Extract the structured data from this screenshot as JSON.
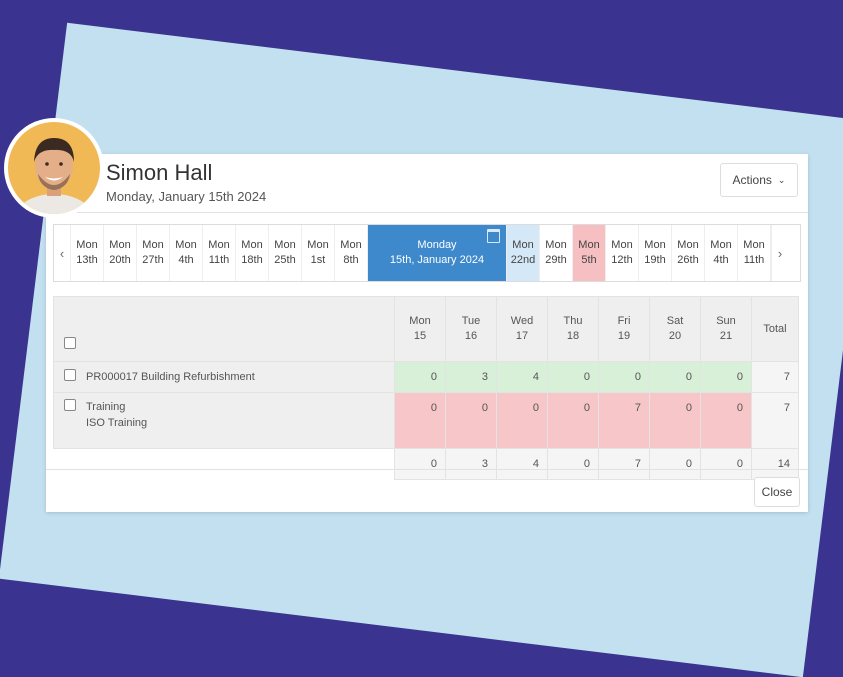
{
  "employee": {
    "name": "Simon Hall",
    "date": "Monday, January 15th 2024"
  },
  "actions_label": "Actions",
  "close_label": "Close",
  "colors": {
    "background": "#3a338f",
    "card": "#c2e0ef",
    "selected_week": "#3d89cc",
    "hours_ok": "#d8efd8",
    "hours_missing": "#f7c6c8"
  },
  "weeks": [
    {
      "day": "Mon",
      "date": "13th",
      "state": "normal"
    },
    {
      "day": "Mon",
      "date": "20th",
      "state": "normal"
    },
    {
      "day": "Mon",
      "date": "27th",
      "state": "normal"
    },
    {
      "day": "Mon",
      "date": "4th",
      "state": "normal"
    },
    {
      "day": "Mon",
      "date": "11th",
      "state": "normal"
    },
    {
      "day": "Mon",
      "date": "18th",
      "state": "normal"
    },
    {
      "day": "Mon",
      "date": "25th",
      "state": "normal"
    },
    {
      "day": "Mon",
      "date": "1st",
      "state": "normal"
    },
    {
      "day": "Mon",
      "date": "8th",
      "state": "normal"
    },
    {
      "day": "Monday",
      "date": "15th, January 2024",
      "state": "selected"
    },
    {
      "day": "Mon",
      "date": "22nd",
      "state": "blue"
    },
    {
      "day": "Mon",
      "date": "29th",
      "state": "normal"
    },
    {
      "day": "Mon",
      "date": "5th",
      "state": "pink"
    },
    {
      "day": "Mon",
      "date": "12th",
      "state": "normal"
    },
    {
      "day": "Mon",
      "date": "19th",
      "state": "normal"
    },
    {
      "day": "Mon",
      "date": "26th",
      "state": "normal"
    },
    {
      "day": "Mon",
      "date": "4th",
      "state": "normal"
    },
    {
      "day": "Mon",
      "date": "11th",
      "state": "normal"
    }
  ],
  "days": [
    {
      "day": "Mon",
      "num": "15"
    },
    {
      "day": "Tue",
      "num": "16"
    },
    {
      "day": "Wed",
      "num": "17"
    },
    {
      "day": "Thu",
      "num": "18"
    },
    {
      "day": "Fri",
      "num": "19"
    },
    {
      "day": "Sat",
      "num": "20"
    },
    {
      "day": "Sun",
      "num": "21"
    }
  ],
  "total_label": "Total",
  "rows": [
    {
      "line1": "PR000017 Building Refurbishment",
      "line2": "",
      "hours": [
        "0",
        "3",
        "4",
        "0",
        "0",
        "0",
        "0"
      ],
      "total": "7",
      "status": "green"
    },
    {
      "line1": "Training",
      "line2": "ISO Training",
      "hours": [
        "0",
        "0",
        "0",
        "0",
        "7",
        "0",
        "0"
      ],
      "total": "7",
      "status": "red"
    }
  ],
  "totals": {
    "hours": [
      "0",
      "3",
      "4",
      "0",
      "7",
      "0",
      "0"
    ],
    "total": "14"
  }
}
